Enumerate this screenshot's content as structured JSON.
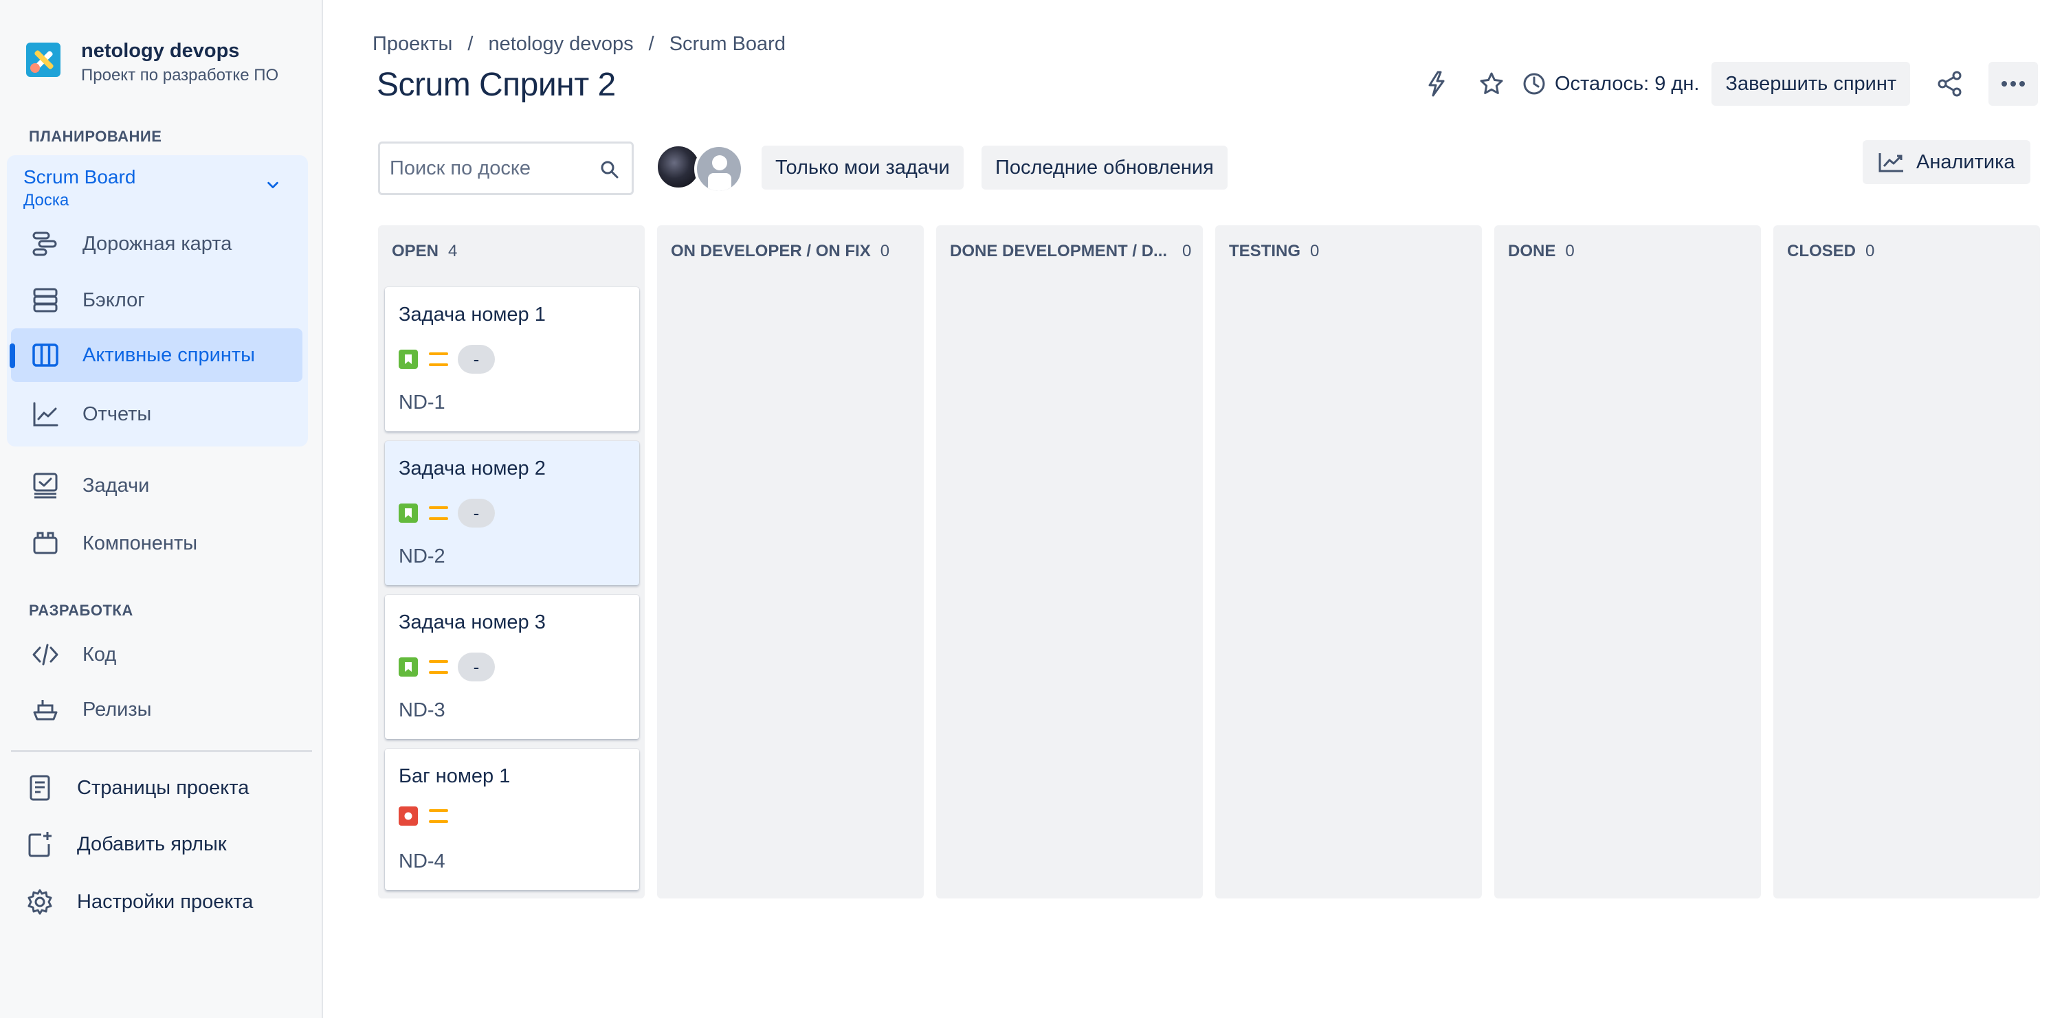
{
  "project": {
    "name": "netology devops",
    "subtitle": "Проект по разработке ПО"
  },
  "sidebar": {
    "planning_title": "ПЛАНИРОВАНИЕ",
    "board": {
      "title": "Scrum Board",
      "subtitle": "Доска"
    },
    "planning_items": [
      {
        "label": "Дорожная карта",
        "icon": "roadmap-icon"
      },
      {
        "label": "Бэклог",
        "icon": "backlog-icon"
      },
      {
        "label": "Активные спринты",
        "icon": "board-icon",
        "active": true
      },
      {
        "label": "Отчеты",
        "icon": "reports-icon"
      }
    ],
    "items": [
      {
        "label": "Задачи",
        "icon": "issues-icon"
      },
      {
        "label": "Компоненты",
        "icon": "components-icon"
      }
    ],
    "dev_title": "РАЗРАБОТКА",
    "dev_items": [
      {
        "label": "Код",
        "icon": "code-icon"
      },
      {
        "label": "Релизы",
        "icon": "releases-icon"
      }
    ],
    "footer_items": [
      {
        "label": "Страницы проекта",
        "icon": "page-icon"
      },
      {
        "label": "Добавить ярлык",
        "icon": "add-shortcut-icon"
      },
      {
        "label": "Настройки проекта",
        "icon": "settings-icon"
      }
    ]
  },
  "breadcrumbs": [
    "Проекты",
    "netology devops",
    "Scrum Board"
  ],
  "page_title": "Scrum Спринт 2",
  "header": {
    "time_left": "Осталось: 9 дн.",
    "complete_sprint": "Завершить спринт"
  },
  "toolbar": {
    "search_placeholder": "Поиск по доске",
    "filter_mine": "Только мои задачи",
    "filter_recent": "Последние обновления",
    "analytics": "Аналитика"
  },
  "columns": [
    {
      "name": "OPEN",
      "count": "4"
    },
    {
      "name": "ON DEVELOPER / ON FIX",
      "count": "0"
    },
    {
      "name": "DONE DEVELOPMENT / D...",
      "count": "0"
    },
    {
      "name": "TESTING",
      "count": "0"
    },
    {
      "name": "DONE",
      "count": "0"
    },
    {
      "name": "CLOSED",
      "count": "0"
    }
  ],
  "cards": [
    {
      "title": "Задача номер 1",
      "type": "story",
      "priority": "medium",
      "estimate": "-",
      "key": "ND-1"
    },
    {
      "title": "Задача номер 2",
      "type": "story",
      "priority": "medium",
      "estimate": "-",
      "key": "ND-2",
      "selected": true
    },
    {
      "title": "Задача номер 3",
      "type": "story",
      "priority": "medium",
      "estimate": "-",
      "key": "ND-3"
    },
    {
      "title": "Баг номер 1",
      "type": "bug",
      "priority": "medium",
      "key": "ND-4"
    }
  ],
  "colors": {
    "accent": "#0C66E4",
    "story": "#63BA3C",
    "bug": "#E5493A",
    "priority_medium": "#FFAB00"
  }
}
